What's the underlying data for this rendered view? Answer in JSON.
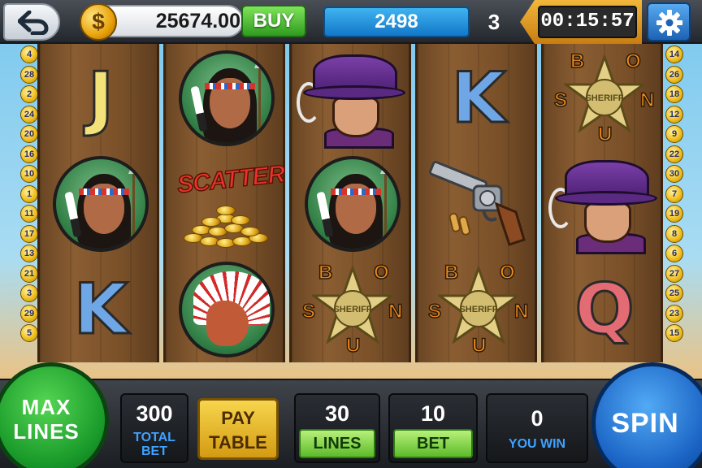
{
  "header": {
    "coin_symbol": "$",
    "coin_balance": "25674.00",
    "buy_label": "BUY",
    "xp_value": "2498",
    "level": "3",
    "timer": "00:15:57"
  },
  "paylines": {
    "left": [
      "4",
      "28",
      "2",
      "24",
      "20",
      "16",
      "10",
      "1",
      "11",
      "17",
      "13",
      "21",
      "3",
      "29",
      "5"
    ],
    "right": [
      "14",
      "26",
      "18",
      "12",
      "9",
      "22",
      "30",
      "7",
      "19",
      "8",
      "6",
      "27",
      "25",
      "23",
      "15"
    ]
  },
  "reels": [
    [
      "J",
      "native-woman",
      "K"
    ],
    [
      "native-woman",
      "scatter",
      "native-chief"
    ],
    [
      "bandit",
      "native-woman",
      "sheriff-bonus"
    ],
    [
      "K",
      "revolver",
      "sheriff-bonus"
    ],
    [
      "sheriff-bonus",
      "bandit",
      "Q"
    ]
  ],
  "symbols": {
    "scatter_text": "SCATTER",
    "sheriff_text": "SHERIFF",
    "bonus_letters": [
      "B",
      "O",
      "N",
      "U",
      "S"
    ]
  },
  "footer": {
    "max_lines_label_1": "MAX",
    "max_lines_label_2": "LINES",
    "total_bet_value": "300",
    "total_bet_label_1": "TOTAL",
    "total_bet_label_2": "BET",
    "pay_table_label_1": "PAY",
    "pay_table_label_2": "TABLE",
    "lines_value": "30",
    "lines_label": "LINES",
    "bet_value": "10",
    "bet_label": "BET",
    "win_value": "0",
    "win_label": "YOU WIN",
    "spin_label": "SPIN"
  },
  "colors": {
    "wood": "#7a5029",
    "buy_green": "#2f9b1f",
    "xp_blue": "#1377c9",
    "max_lines_green": "#199a2a",
    "spin_blue": "#1a63c4",
    "paytable_gold": "#d39b12",
    "label_blue": "#3fa2ff"
  },
  "icons": {
    "back": "back-arrow-icon",
    "coin": "dollar-coin-icon",
    "settings": "gear-icon"
  }
}
